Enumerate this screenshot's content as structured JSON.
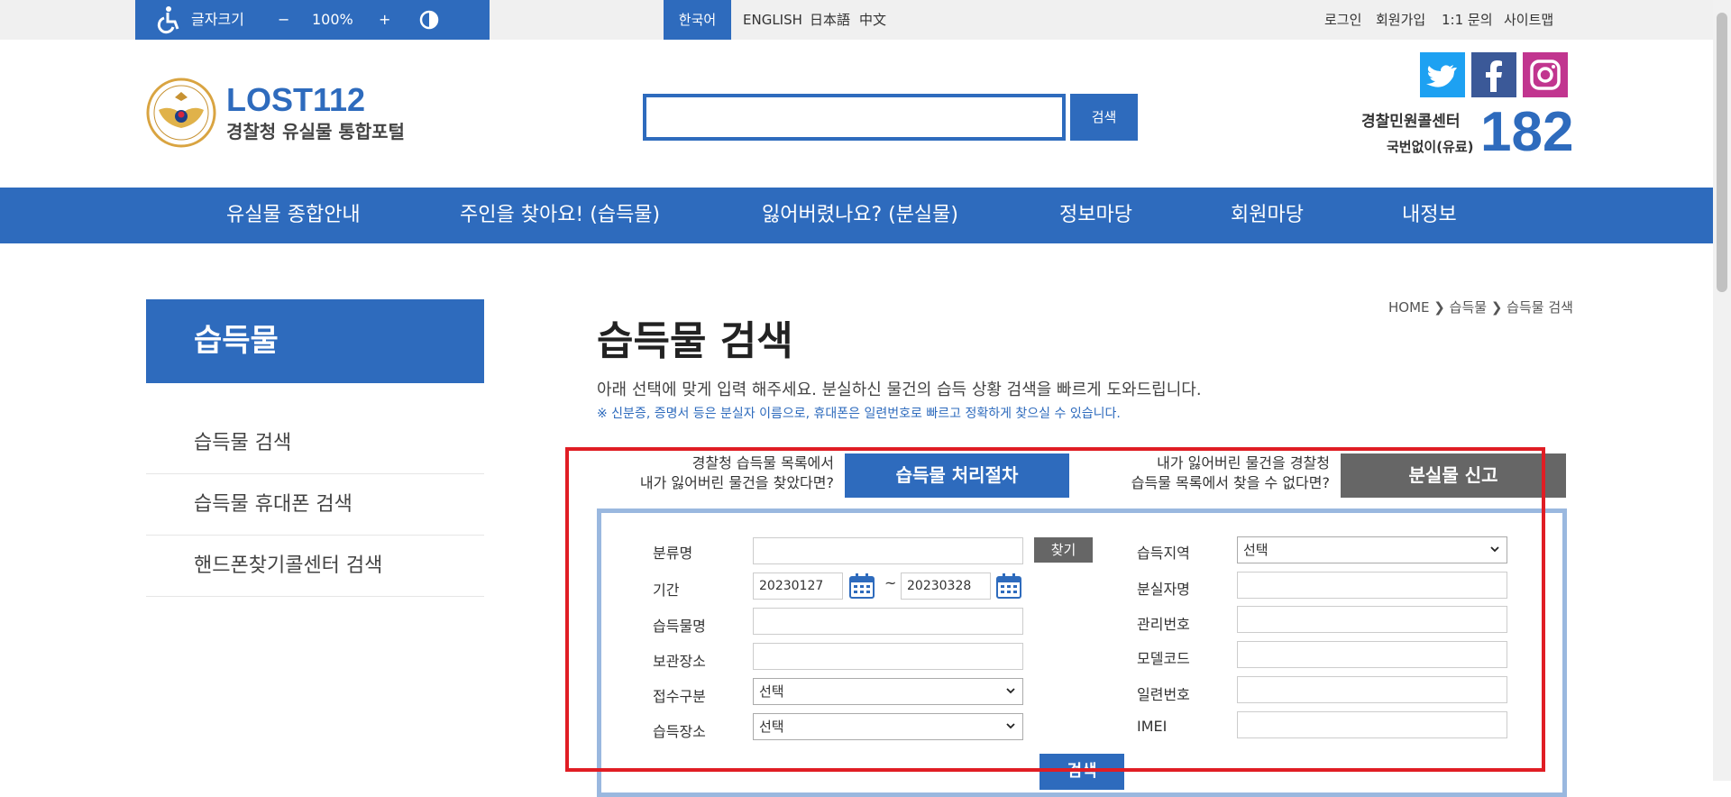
{
  "accessibility": {
    "font_size_label": "글자크기",
    "minus": "−",
    "zoom": "100%",
    "plus": "+"
  },
  "languages": [
    "한국어",
    "ENGLISH",
    "日本語",
    "中文"
  ],
  "util_links": [
    "로그인",
    "회원가입",
    "1:1 문의",
    "사이트맵"
  ],
  "logo": {
    "title": "LOST112",
    "subtitle": "경찰청 유실물 통합포털"
  },
  "search": {
    "value": "",
    "button_label": "검색"
  },
  "call_center": {
    "label": "경찰민원콜센터",
    "sub": "국번없이(유료)",
    "number": "182"
  },
  "nav": [
    "유실물 종합안내",
    "주인을 찾아요! (습득물)",
    "잃어버렸나요? (분실물)",
    "정보마당",
    "회원마당",
    "내정보"
  ],
  "sidebar": {
    "heading": "습득물",
    "items": [
      "습득물 검색",
      "습득물 휴대폰 검색",
      "핸드폰찾기콜센터 검색"
    ]
  },
  "breadcrumb": {
    "home": "HOME",
    "level1": "습득물",
    "level2": "습득물 검색"
  },
  "page": {
    "title": "습득물 검색",
    "description": "아래 선택에 맞게 입력 해주세요. 분실하신 물건의 습득 상황 검색을 빠르게 도와드립니다.",
    "note": "※ 신분증, 증명서 등은 분실자 이름으로, 휴대폰은 일련번호로 빠르고 정확하게 찾으실 수 있습니다."
  },
  "promo_left": {
    "line1": "경찰청 습득물 목록에서",
    "line2": "내가 잃어버린 물건을 찾았다면?",
    "button": "습득물 처리절차"
  },
  "promo_right": {
    "line1": "내가 잃어버린 물건을 경찰청",
    "line2": "습득물 목록에서 찾을 수 없다면?",
    "button": "분실물 신고"
  },
  "form": {
    "category_label": "분류명",
    "category_value": "",
    "find_button": "찾기",
    "period_label": "기간",
    "date_from": "20230127",
    "tilde": "~",
    "date_to": "20230328",
    "item_name_label": "습득물명",
    "item_name_value": "",
    "storage_label": "보관장소",
    "storage_value": "",
    "receipt_label": "접수구분",
    "receipt_value": "선택",
    "found_place_label": "습득장소",
    "found_place_value": "선택",
    "region_label": "습득지역",
    "region_value": "선택",
    "loser_label": "분실자명",
    "loser_value": "",
    "mgmt_label": "관리번호",
    "mgmt_value": "",
    "model_label": "모델코드",
    "model_value": "",
    "serial_label": "일련번호",
    "serial_value": "",
    "imei_label": "IMEI",
    "imei_value": "",
    "submit_label": "검색"
  },
  "colors": {
    "primary": "#2e6bbd",
    "highlight": "#e01d24",
    "gray_button": "#666666"
  }
}
